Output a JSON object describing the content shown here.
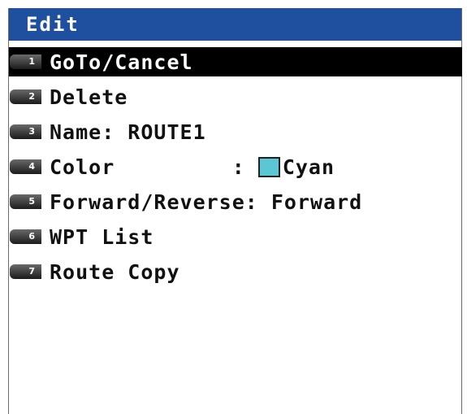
{
  "title": "Edit",
  "items": [
    {
      "num": "1",
      "label": "GoTo/Cancel"
    },
    {
      "num": "2",
      "label": "Delete"
    },
    {
      "num": "3",
      "label": "Name: ROUTE1"
    },
    {
      "num": "4",
      "label": "Color         : ",
      "value": "Cyan",
      "swatch_color": "#5cc7d4"
    },
    {
      "num": "5",
      "label": "Forward/Reverse: Forward"
    },
    {
      "num": "6",
      "label": "WPT List"
    },
    {
      "num": "7",
      "label": "Route Copy"
    }
  ],
  "colors": {
    "titlebar": "#1f4f9f",
    "selected_background": "#000000"
  }
}
